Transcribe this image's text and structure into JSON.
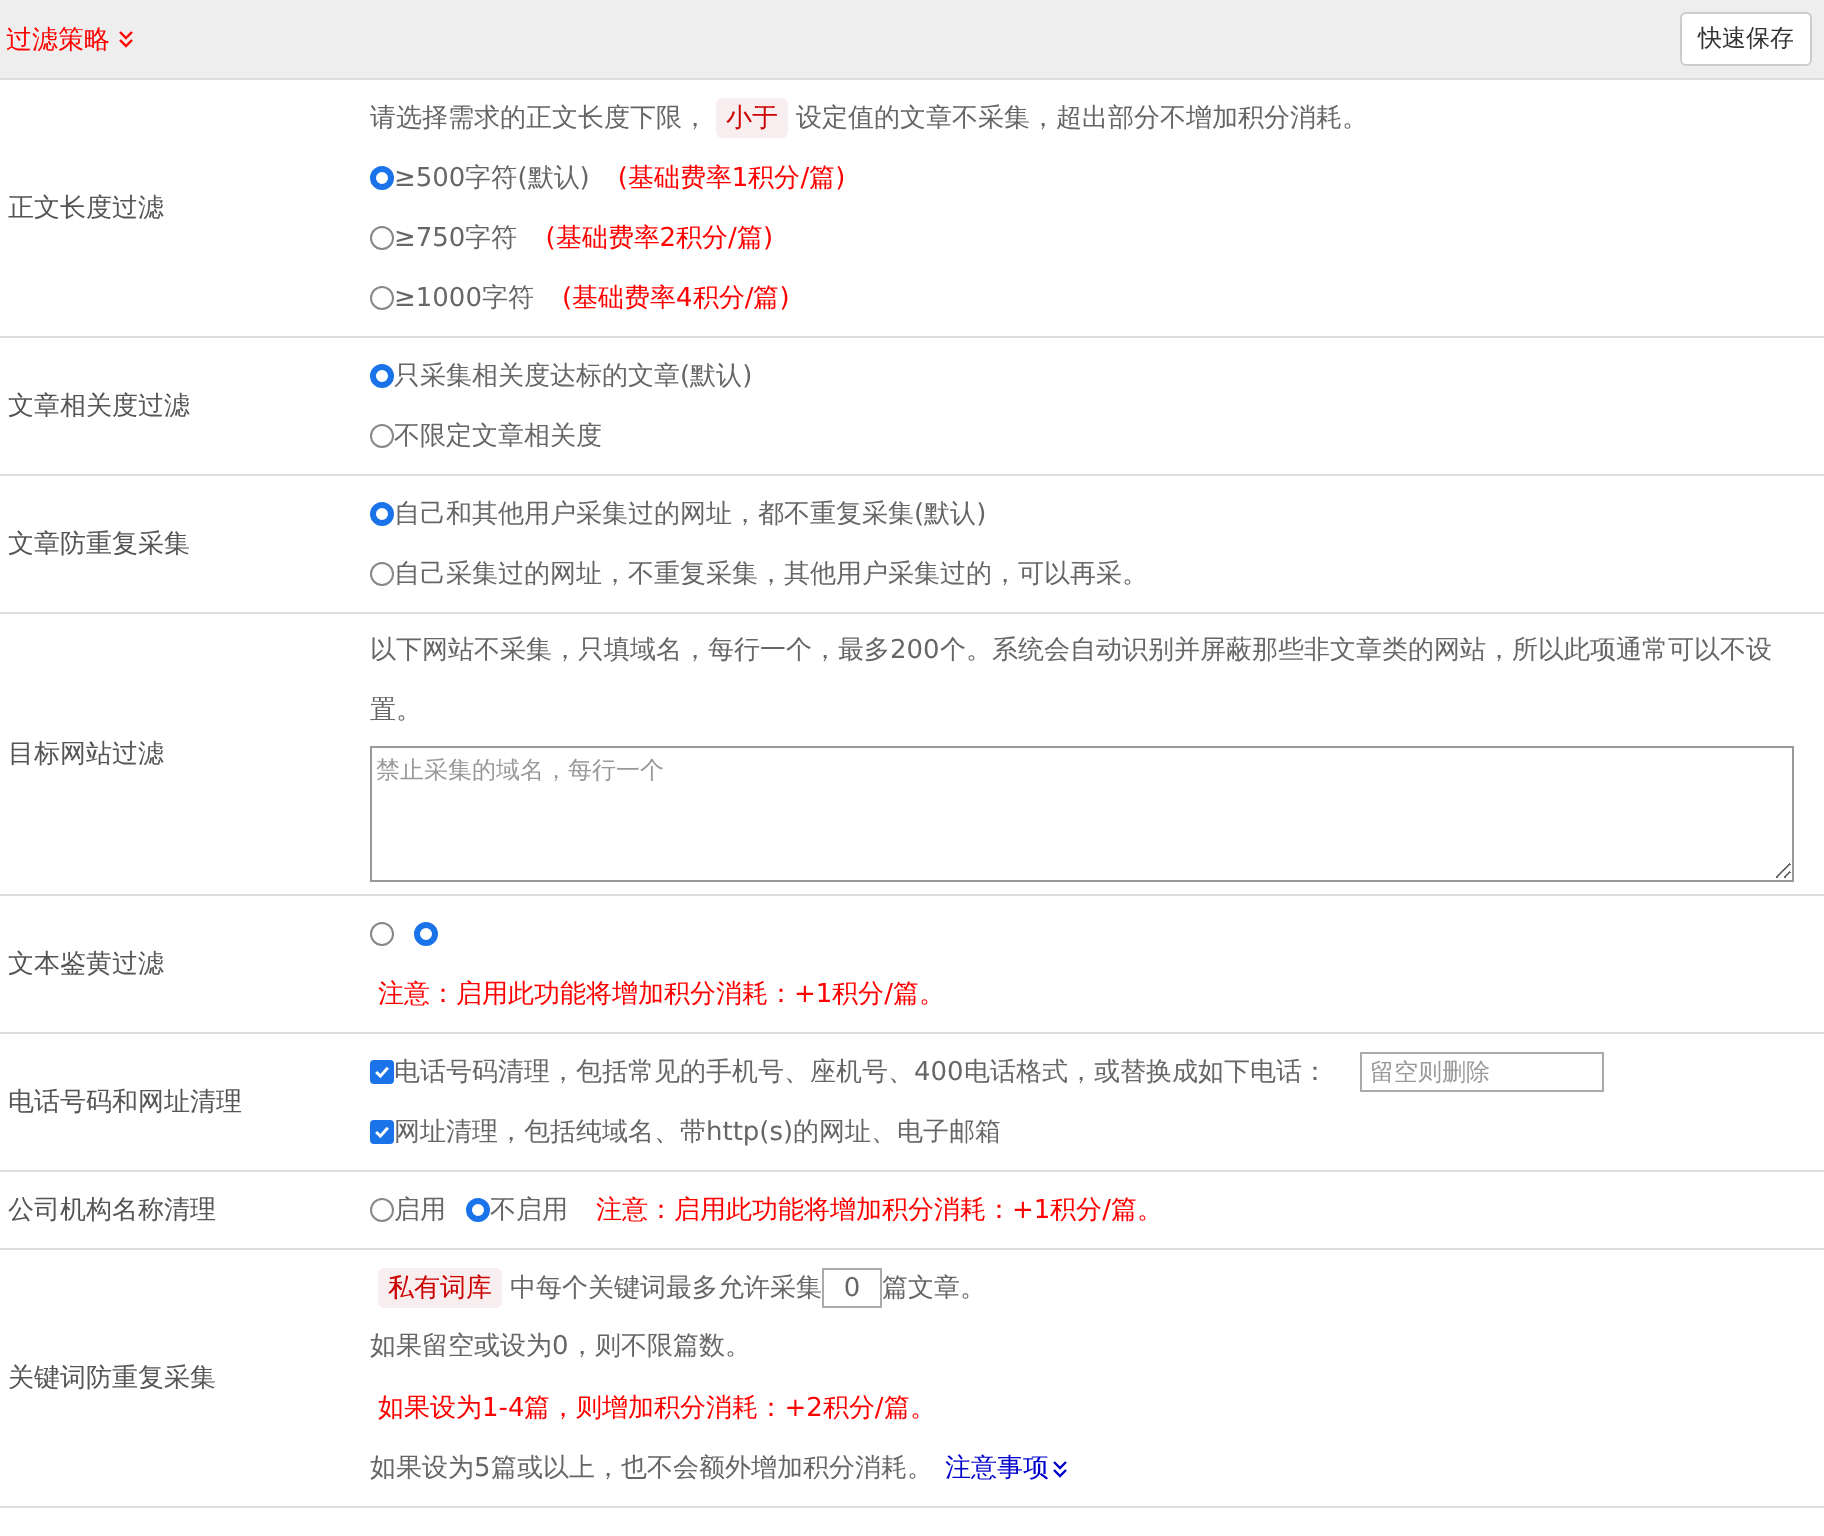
{
  "header": {
    "title": "过滤策略",
    "button": "快速保存"
  },
  "rows": [
    {
      "label": "正文长度过滤",
      "lines": [
        {
          "parts": [
            {
              "kind": "text",
              "text": "请选择需求的正文长度下限，"
            },
            {
              "kind": "tag",
              "text": "小于"
            },
            {
              "kind": "text",
              "text": "设定值的文章不采集，超出部分不增加积分消耗。"
            }
          ]
        },
        {
          "parts": [
            {
              "kind": "radio",
              "label": "≥500字符(默认)",
              "selected": true
            },
            {
              "kind": "note",
              "text": "(基础费率1积分/篇)"
            }
          ]
        },
        {
          "parts": [
            {
              "kind": "radio",
              "label": "≥750字符",
              "selected": false
            },
            {
              "kind": "note",
              "text": "(基础费率2积分/篇)"
            }
          ]
        },
        {
          "parts": [
            {
              "kind": "radio",
              "label": "≥1000字符",
              "selected": false
            },
            {
              "kind": "note",
              "text": "(基础费率4积分/篇)"
            }
          ]
        }
      ]
    },
    {
      "label": "文章相关度过滤",
      "lines": [
        {
          "parts": [
            {
              "kind": "radio",
              "label": "只采集相关度达标的文章(默认)",
              "selected": true
            }
          ]
        },
        {
          "parts": [
            {
              "kind": "radio",
              "label": "不限定文章相关度",
              "selected": false
            }
          ]
        }
      ]
    },
    {
      "label": "文章防重复采集",
      "lines": [
        {
          "parts": [
            {
              "kind": "radio",
              "label": "自己和其他用户采集过的网址，都不重复采集(默认)",
              "selected": true
            }
          ]
        },
        {
          "parts": [
            {
              "kind": "radio",
              "label": "自己采集过的网址，不重复采集，其他用户采集过的，可以再采。",
              "selected": false
            }
          ]
        }
      ]
    },
    {
      "label": "目标网站过滤",
      "lines": [
        {
          "parts": [
            {
              "kind": "text",
              "text": "以下网站不采集，只填域名，每行一个，最多200个。系统会自动识别并屏蔽那些非文章类的网站，所以此项通常可以不设置。"
            }
          ]
        },
        {
          "parts": [
            {
              "kind": "textarea",
              "placeholder": "禁止采集的域名，每行一个"
            }
          ]
        }
      ]
    },
    {
      "label": "文本鉴黄过滤",
      "lines": [
        {
          "parts": [
            {
              "kind": "radio",
              "selected": false
            },
            {
              "kind": "radio",
              "selected": true
            }
          ]
        },
        {
          "parts": [
            {
              "kind": "note",
              "text": "注意：启用此功能将增加积分消耗：+1积分/篇。"
            }
          ]
        }
      ]
    },
    {
      "label": "电话号码和网址清理",
      "lines": [
        {
          "parts": [
            {
              "kind": "checkbox",
              "label": "电话号码清理，包括常见的手机号、座机号、400电话格式，或替换成如下电话：",
              "checked": true
            },
            {
              "kind": "input",
              "placeholder": "留空则删除"
            }
          ]
        },
        {
          "parts": [
            {
              "kind": "checkbox",
              "label": "网址清理，包括纯域名、带http(s)的网址、电子邮箱",
              "checked": true
            }
          ]
        }
      ]
    },
    {
      "label": "公司机构名称清理",
      "lines": [
        {
          "parts": [
            {
              "kind": "radio",
              "label": "启用",
              "selected": false
            },
            {
              "kind": "radio",
              "label": "不启用",
              "selected": true
            },
            {
              "kind": "note",
              "text": "注意：启用此功能将增加积分消耗：+1积分/篇。"
            }
          ]
        }
      ]
    },
    {
      "label": "关键词防重复采集",
      "lines": [
        {
          "parts": [
            {
              "kind": "tag",
              "text": "私有词库"
            },
            {
              "kind": "text",
              "text": "中每个关键词最多允许采集"
            },
            {
              "kind": "number",
              "value": "0"
            },
            {
              "kind": "text",
              "text": "篇文章。"
            }
          ]
        },
        {
          "parts": [
            {
              "kind": "text",
              "text": "如果留空或设为0，则不限篇数。"
            }
          ]
        },
        {
          "parts": [
            {
              "kind": "note",
              "text": "如果设为1-4篇，则增加积分消耗：+2积分/篇。"
            }
          ]
        },
        {
          "parts": [
            {
              "kind": "text",
              "text": "如果设为5篇或以上，也不会额外增加积分消耗。"
            },
            {
              "kind": "link",
              "text": "注意事项"
            }
          ]
        }
      ]
    }
  ]
}
